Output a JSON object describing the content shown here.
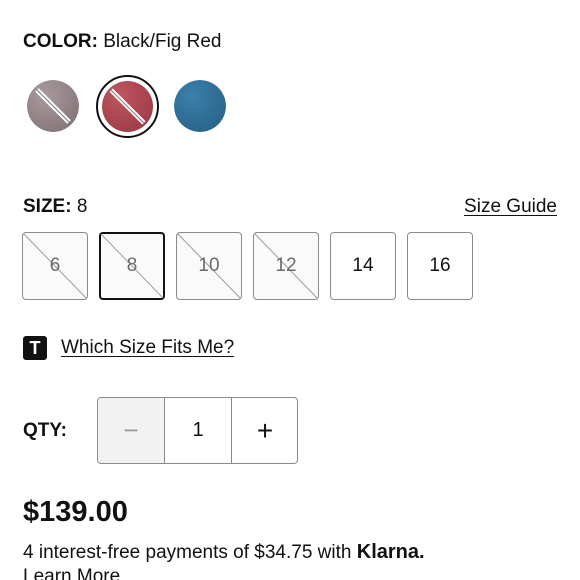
{
  "color": {
    "label": "COLOR:",
    "value": "Black/Fig Red",
    "swatches": [
      {
        "name": "grey-mauve",
        "color": "#8e7f82",
        "available": false
      },
      {
        "name": "fig-red",
        "color": "#a8424c",
        "available": false,
        "selected": true
      },
      {
        "name": "blue",
        "color": "#2f6f97",
        "available": true
      }
    ]
  },
  "size": {
    "label": "SIZE:",
    "value": "8",
    "guide_link": "Size Guide",
    "options": [
      {
        "label": "6",
        "available": false,
        "selected": false
      },
      {
        "label": "8",
        "available": false,
        "selected": true
      },
      {
        "label": "10",
        "available": false,
        "selected": false
      },
      {
        "label": "12",
        "available": false,
        "selected": false
      },
      {
        "label": "14",
        "available": true,
        "selected": false
      },
      {
        "label": "16",
        "available": true,
        "selected": false
      }
    ]
  },
  "fit": {
    "icon_letter": "T",
    "link": "Which Size Fits Me?"
  },
  "qty": {
    "label": "QTY:",
    "minus": "−",
    "value": "1",
    "plus": "+"
  },
  "price": "$139.00",
  "installments": {
    "text": "4 interest-free payments of $34.75 with",
    "brand": "Klarna.",
    "learn_more": "Learn More"
  }
}
